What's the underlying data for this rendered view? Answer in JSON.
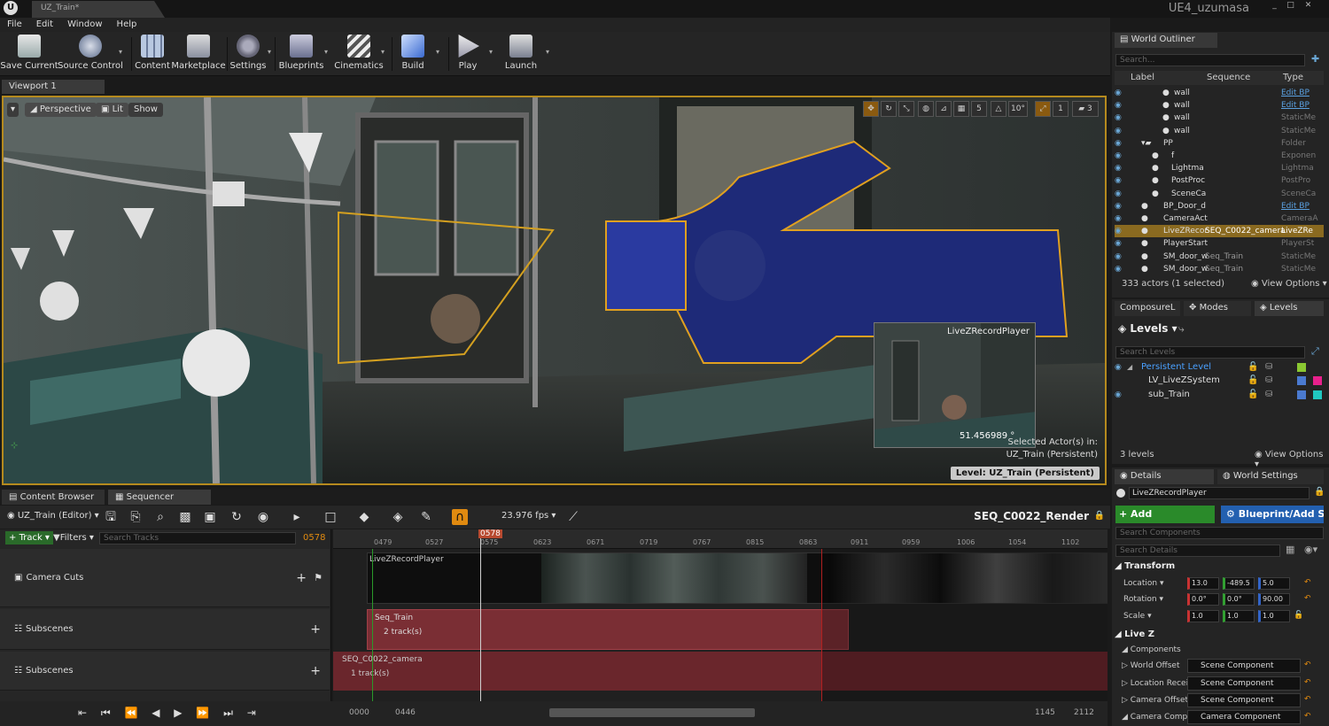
{
  "window": {
    "logo": "U",
    "doc_tab": "UZ_Train*",
    "project": "UE4_uzumasa",
    "controls": [
      "_",
      "□",
      "✕"
    ]
  },
  "menu": [
    "File",
    "Edit",
    "Window",
    "Help"
  ],
  "toolbar": [
    {
      "label": "Save Current",
      "icon": "save-icon"
    },
    {
      "label": "Source Control",
      "icon": "source-control-icon"
    },
    {
      "label": "Content",
      "icon": "content-icon"
    },
    {
      "label": "Marketplace",
      "icon": "marketplace-icon"
    },
    {
      "label": "Settings",
      "icon": "settings-icon"
    },
    {
      "label": "Blueprints",
      "icon": "blueprints-icon"
    },
    {
      "label": "Cinematics",
      "icon": "cinematics-icon"
    },
    {
      "label": "Build",
      "icon": "build-icon"
    },
    {
      "label": "Play",
      "icon": "play-icon"
    },
    {
      "label": "Launch",
      "icon": "launch-icon"
    }
  ],
  "viewport": {
    "tab": "Viewport 1",
    "perspective": "Perspective",
    "lit": "Lit",
    "show": "Show",
    "grid_value": "5",
    "angle_value": "10°",
    "scale_value": "1",
    "camera_speed": "3",
    "pip_label": "LiveZRecordPlayer",
    "distance": "51.456989 °",
    "selected_line1": "Selected Actor(s) in:",
    "selected_line2": "UZ_Train (Persistent)",
    "level_badge": "Level:  UZ_Train (Persistent)"
  },
  "bottom_tabs": [
    "Content Browser",
    "Sequencer"
  ],
  "sequencer": {
    "editor_label": "UZ_Train (Editor)",
    "fps": "23.976 fps",
    "sequence_name": "SEQ_C0022_Render",
    "track_button": "Track",
    "filters_button": "Filters",
    "search_placeholder": "Search Tracks",
    "current_frame": "0578",
    "playhead_label": "0578",
    "ruler_ticks": [
      "0479",
      "0527",
      "0575",
      "0623",
      "0671",
      "0719",
      "0767",
      "0815",
      "0863",
      "0911",
      "0959",
      "1006",
      "1054",
      "1102"
    ],
    "tracks": [
      {
        "name": "Camera Cuts"
      },
      {
        "name": "Subscenes"
      },
      {
        "name": "Subscenes"
      }
    ],
    "clips": {
      "camera_clip": "LiveZRecordPlayer",
      "seq_train": "Seq_Train",
      "seq_train_tracks": "2 track(s)",
      "seq_camera": "SEQ_C0022_camera",
      "seq_camera_tracks": "1 track(s)"
    },
    "range": {
      "start": "0000",
      "in": "0446",
      "out": "1145",
      "end": "2112"
    }
  },
  "outliner": {
    "tab": "World Outliner",
    "search_placeholder": "Search...",
    "columns": [
      "Label",
      "Sequence",
      "Type"
    ],
    "rows": [
      {
        "label": "wall",
        "sequence": "",
        "type": "Edit BP",
        "link": true,
        "indent": 3
      },
      {
        "label": "wall",
        "sequence": "",
        "type": "Edit BP",
        "link": true,
        "indent": 3
      },
      {
        "label": "wall",
        "sequence": "",
        "type": "StaticMe",
        "link": false,
        "indent": 3
      },
      {
        "label": "wall",
        "sequence": "",
        "type": "StaticMe",
        "link": false,
        "indent": 3
      },
      {
        "label": "PP",
        "sequence": "",
        "type": "Folder",
        "link": false,
        "indent": 1
      },
      {
        "label": "f",
        "sequence": "",
        "type": "Exponen",
        "link": false,
        "indent": 2
      },
      {
        "label": "Lightma",
        "sequence": "",
        "type": "Lightma",
        "link": false,
        "indent": 2
      },
      {
        "label": "PostProc",
        "sequence": "",
        "type": "PostPro",
        "link": false,
        "indent": 2
      },
      {
        "label": "SceneCa",
        "sequence": "",
        "type": "SceneCa",
        "link": false,
        "indent": 2
      },
      {
        "label": "BP_Door_d",
        "sequence": "",
        "type": "Edit BP",
        "link": true,
        "indent": 1
      },
      {
        "label": "CameraAct",
        "sequence": "",
        "type": "CameraA",
        "link": false,
        "indent": 1
      },
      {
        "label": "LiveZRecor",
        "sequence": "SEQ_C0022_camera",
        "type": "LiveZRe",
        "link": false,
        "indent": 1,
        "selected": true
      },
      {
        "label": "PlayerStart",
        "sequence": "",
        "type": "PlayerSt",
        "link": false,
        "indent": 1
      },
      {
        "label": "SM_door_w",
        "sequence": "Seq_Train",
        "type": "StaticMe",
        "link": false,
        "indent": 1
      },
      {
        "label": "SM_door_w",
        "sequence": "Seq_Train",
        "type": "StaticMe",
        "link": false,
        "indent": 1
      }
    ],
    "count": "333 actors (1 selected)",
    "view_options": "View Options"
  },
  "levels_panel": {
    "tabs": [
      "ComposureL",
      "Modes",
      "Levels"
    ],
    "title": "Levels",
    "search_placeholder": "Search Levels",
    "levels": [
      {
        "name": "Persistent Level",
        "color": "#8ac832",
        "persistent": true
      },
      {
        "name": "LV_LiveZSystem",
        "color": "#e8208c",
        "persistent": false
      },
      {
        "name": "sub_Train",
        "color": "#20c8c0",
        "persistent": false
      }
    ],
    "count": "3 levels",
    "view_options": "View Options"
  },
  "details": {
    "tabs": [
      "Details",
      "World Settings"
    ],
    "actor_name": "LiveZRecordPlayer",
    "add_component": "+ Add Component",
    "blueprint": "Blueprint/Add S",
    "search_components": "Search Components",
    "search_details": "Search Details",
    "transform_header": "Transform",
    "location_label": "Location",
    "location": [
      "13.0",
      "-489.5",
      "5.0"
    ],
    "rotation_label": "Rotation",
    "rotation": [
      "0.0°",
      "0.0°",
      "90.00"
    ],
    "scale_label": "Scale",
    "scale": [
      "1.0",
      "1.0",
      "1.0"
    ],
    "livez_header": "Live Z",
    "components_header": "Components",
    "components": [
      {
        "label": "World Offset",
        "value": "Scene Component"
      },
      {
        "label": "Location Recei",
        "value": "Scene Component"
      },
      {
        "label": "Camera Offset",
        "value": "Scene Component"
      },
      {
        "label": "Camera Compo",
        "value": "Camera Component"
      }
    ]
  }
}
